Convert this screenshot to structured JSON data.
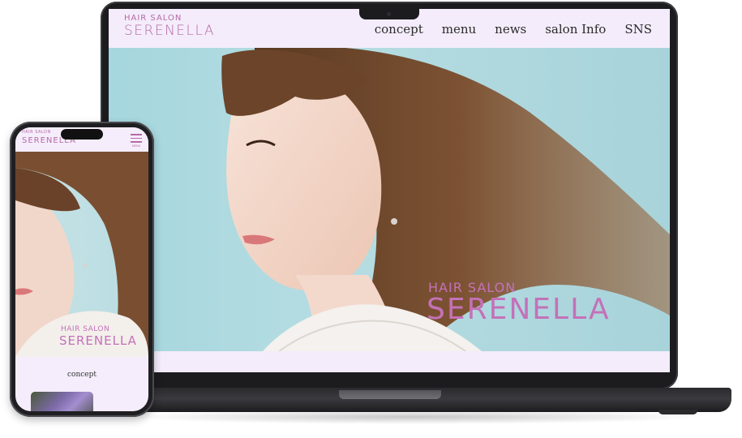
{
  "site": {
    "logo_small": "HAIR SALON",
    "logo_big": "SERENELLA"
  },
  "nav": [
    {
      "label": "concept"
    },
    {
      "label": "menu"
    },
    {
      "label": "news"
    },
    {
      "label": "salon Info"
    },
    {
      "label": "SNS"
    }
  ],
  "hero": {
    "title_small": "HAIR SALON",
    "title_big": "SERENELLA"
  },
  "mobile": {
    "logo_small": "HAIR SALON",
    "logo_big": "SERENELLA",
    "menu_label": "MENU",
    "hero_title_small": "HAIR SALON",
    "hero_title_big": "SERENELLA",
    "section_heading": "concept"
  },
  "colors": {
    "brand_pink": "#c471b8",
    "header_bg": "#f4ecfb",
    "sky": "#a6d6de"
  }
}
